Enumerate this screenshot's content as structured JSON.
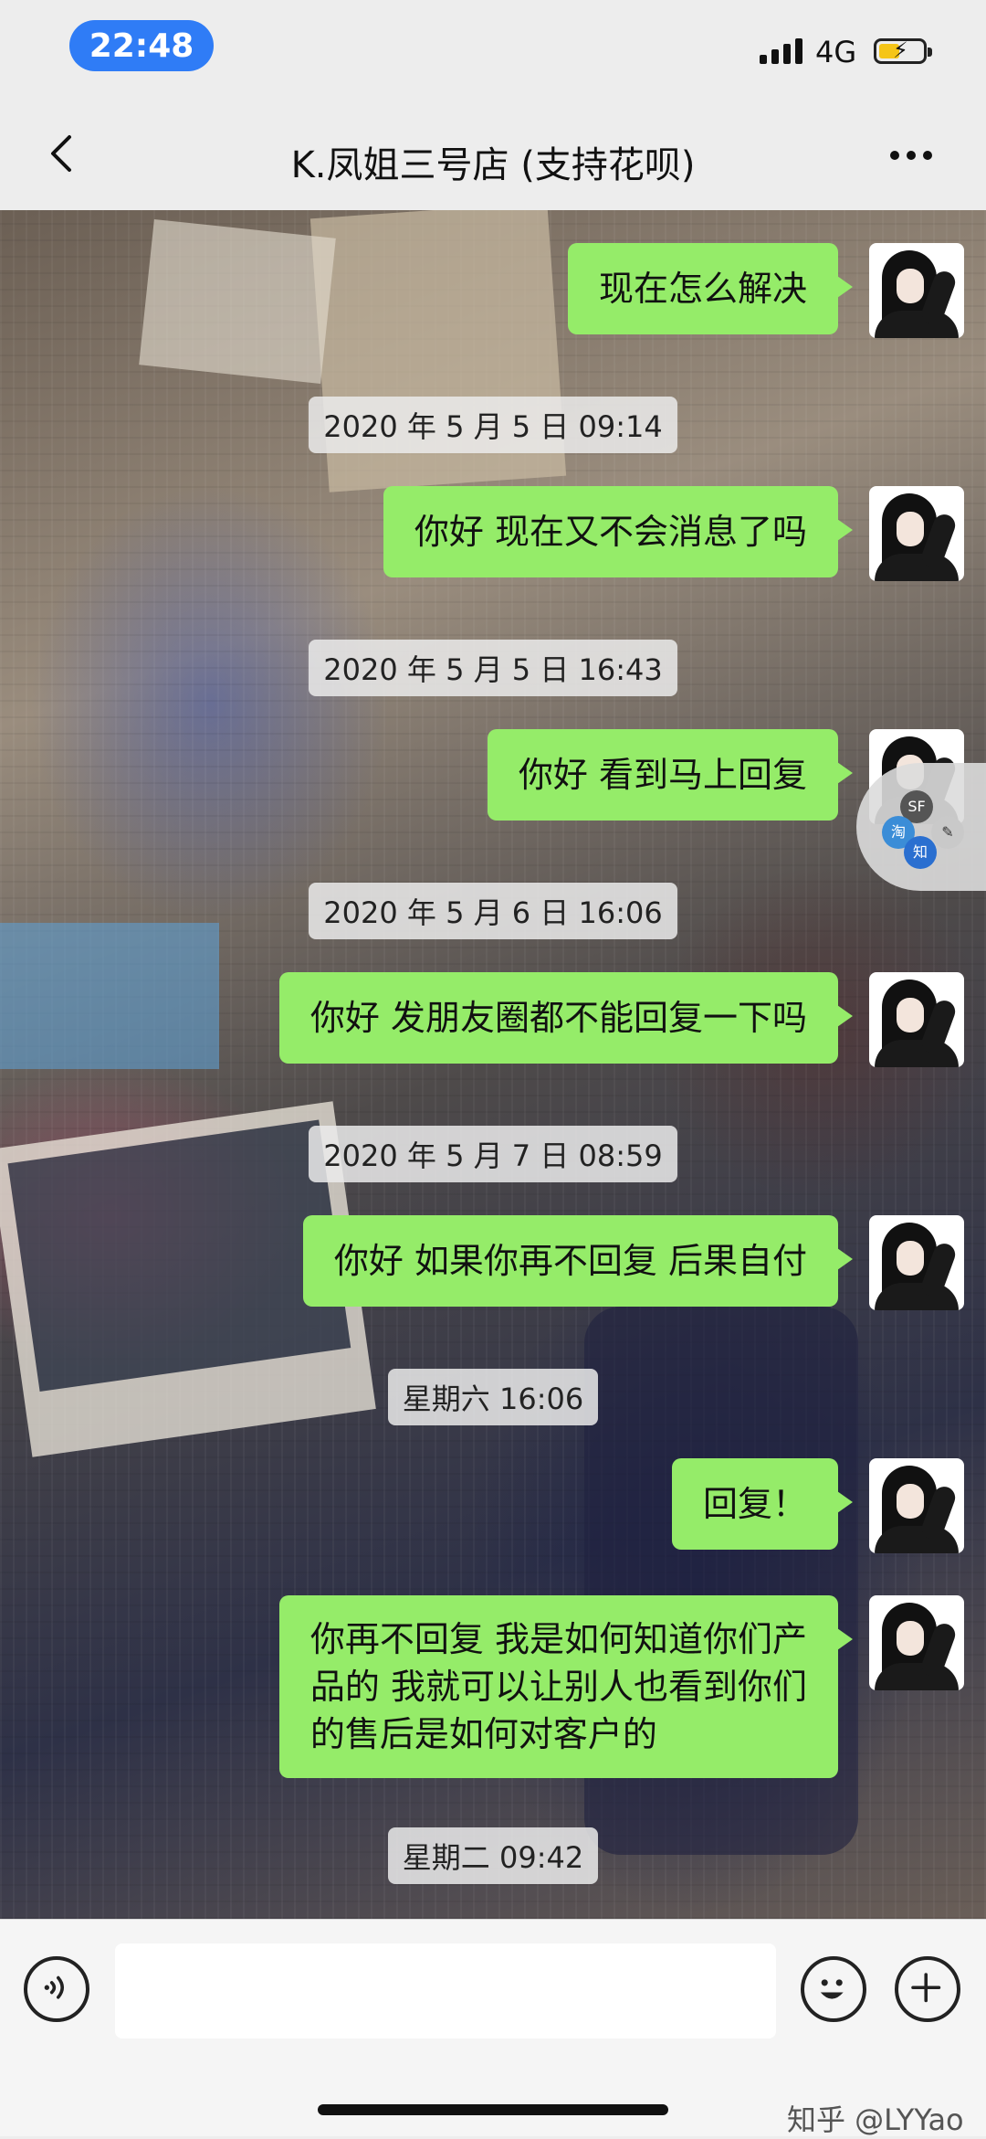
{
  "status_bar": {
    "time": "22:48",
    "network": "4G",
    "signal_icon": "signal-bars-icon",
    "battery_icon": "battery-charging-icon"
  },
  "header": {
    "title": "K.凤姐三号店 (支持花呗)",
    "back_icon": "chevron-left-icon",
    "more_icon": "more-dots-icon"
  },
  "accent_colors": {
    "bubble": "#95ec69",
    "time_pill": "#2f7cf6"
  },
  "messages": [
    {
      "text": "现在怎么解决"
    },
    {
      "timestamp": "2020 年 5 月 5 日 09:14",
      "text": "你好 现在又不会消息了吗"
    },
    {
      "timestamp": "2020 年 5 月 5 日 16:43",
      "text": "你好 看到马上回复"
    },
    {
      "timestamp": "2020 年 5 月 6 日 16:06",
      "text": "你好 发朋友圈都不能回复一下吗"
    },
    {
      "timestamp": "2020 年 5 月 7 日 08:59",
      "text": "你好 如果你再不回复 后果自付"
    },
    {
      "timestamp": "星期六 16:06",
      "text": "回复！"
    },
    {
      "text_lines": [
        "你再不回复 我是如何知道你们产",
        "品的 我就可以让别人也看到你们",
        "的售后是如何对客户的"
      ]
    }
  ],
  "last_timestamp": "星期二 09:42",
  "floating_window": {
    "labels": [
      "SF",
      "淘",
      "知",
      "✎"
    ]
  },
  "input_bar": {
    "voice_icon": "voice-icon",
    "emoji_icon": "emoji-icon",
    "plus_icon": "plus-circle-icon",
    "value": ""
  },
  "watermark": "知乎 @LYYao"
}
